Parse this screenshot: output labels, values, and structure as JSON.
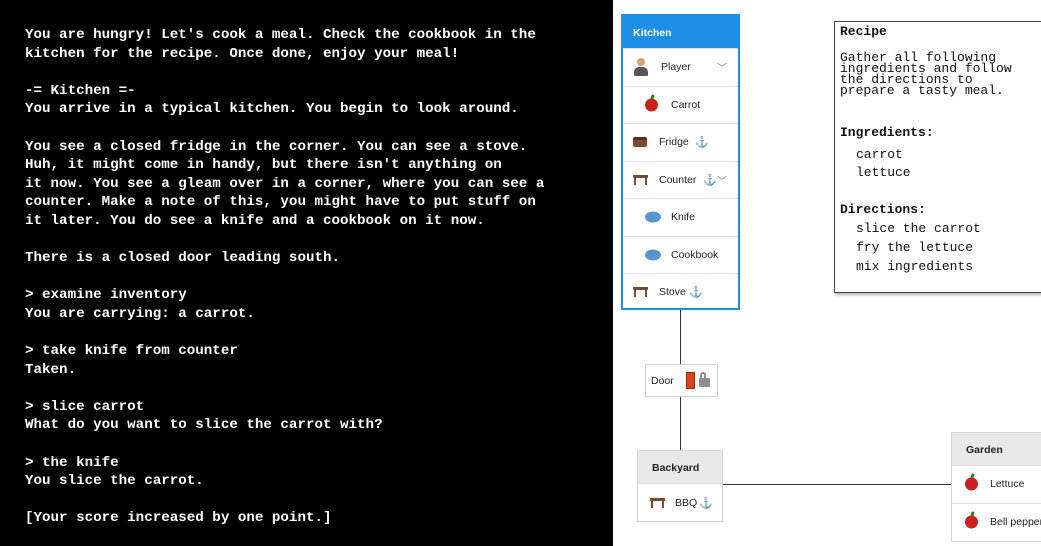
{
  "terminal": {
    "text": "You are hungry! Let's cook a meal. Check the cookbook in the\nkitchen for the recipe. Once done, enjoy your meal!\n\n-= Kitchen =-\nYou arrive in a typical kitchen. You begin to look around.\n\nYou see a closed fridge in the corner. You can see a stove.\nHuh, it might come in handy, but there isn't anything on\nit now. You see a gleam over in a corner, where you can see a\ncounter. Make a note of this, you might have to put stuff on\nit later. You do see a knife and a cookbook on it now.\n\nThere is a closed door leading south.\n\n> examine inventory\nYou are carrying: a carrot.\n\n> take knife from counter\nTaken.\n\n> slice carrot\nWhat do you want to slice the carrot with?\n\n> the knife\nYou slice the carrot.\n\n[Your score increased by one point.]"
  },
  "kitchen": {
    "title": "Kitchen",
    "player": "Player",
    "carrot": "Carrot",
    "fridge": "Fridge",
    "counter": "Counter",
    "knife": "Knife",
    "cookbook": "Cookbook",
    "stove": "Stove"
  },
  "door": {
    "label": "Door"
  },
  "backyard": {
    "title": "Backyard",
    "bbq": "BBQ"
  },
  "garden": {
    "title": "Garden",
    "lettuce": "Lettuce",
    "bell_pepper": "Bell pepper"
  },
  "recipe": {
    "title": "Recipe",
    "description": "Gather all following\ningredients and follow\nthe directions to\nprepare a tasty meal.",
    "ingredients_heading": "Ingredients:",
    "ingredients": [
      "carrot",
      "lettuce"
    ],
    "directions_heading": "Directions:",
    "directions": [
      "slice the carrot",
      "fry the lettuce",
      "mix ingredients"
    ]
  },
  "icons": {
    "anchor": "⚓",
    "chevron": "﹀"
  },
  "colors": {
    "kitchen_accent": "#1f8ee6",
    "apple": "#cc1f1f",
    "tool": "#5a94cf",
    "door": "#d9431f"
  }
}
